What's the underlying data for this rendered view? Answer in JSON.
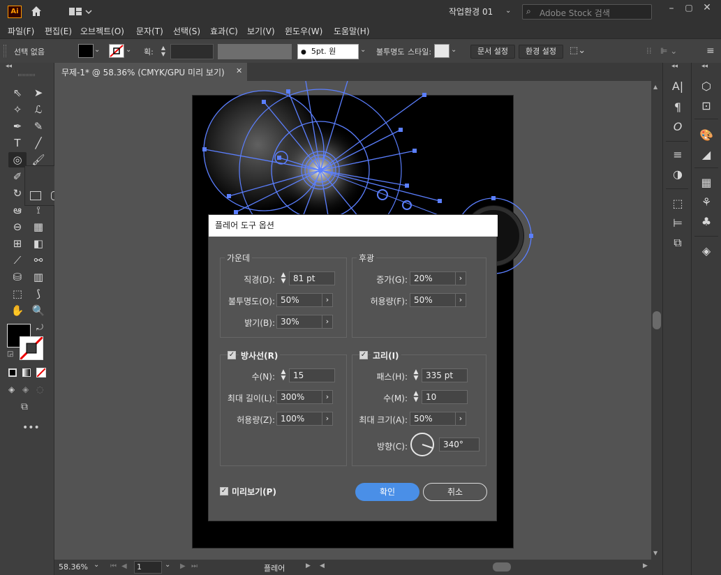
{
  "app": {
    "logo": "Ai",
    "workspace": "작업환경 01",
    "search_placeholder": "Adobe Stock 검색"
  },
  "menu": [
    "파일(F)",
    "편집(E)",
    "오브젝트(O)",
    "문자(T)",
    "선택(S)",
    "효과(C)",
    "보기(V)",
    "윈도우(W)",
    "도움말(H)"
  ],
  "control": {
    "selection": "선택 없음",
    "stroke_label": "획:",
    "brush": "5pt. 원",
    "opacity_label": "불투명도",
    "style_label": "스타일:",
    "doc_setup": "문서 설정",
    "prefs": "환경 설정"
  },
  "tab": {
    "title": "무제-1* @ 58.36% (CMYK/GPU 미리 보기)"
  },
  "status": {
    "zoom": "58.36%",
    "page": "1",
    "tool": "플레어"
  },
  "dialog": {
    "title": "플레어 도구 옵션",
    "center": {
      "title": "가운데",
      "diameter_label": "직경(D):",
      "diameter": "81 pt",
      "opacity_label": "불투명도(O):",
      "opacity": "50%",
      "brightness_label": "밝기(B):",
      "brightness": "30%"
    },
    "halo": {
      "title": "후광",
      "growth_label": "증가(G):",
      "growth": "20%",
      "fuzz_label": "허용량(F):",
      "fuzz": "50%"
    },
    "rays": {
      "title": "방사선(R)",
      "checked": true,
      "count_label": "수(N):",
      "count": "15",
      "longest_label": "최대 길이(L):",
      "longest": "300%",
      "fuzz_label": "허용량(Z):",
      "fuzz": "100%"
    },
    "rings": {
      "title": "고리(I)",
      "checked": true,
      "path_label": "패스(H):",
      "path": "335 pt",
      "count_label": "수(M):",
      "count": "10",
      "largest_label": "최대 크기(A):",
      "largest": "50%",
      "direction_label": "방향(C):",
      "direction": "340°"
    },
    "preview_label": "미리보기(P)",
    "preview_checked": true,
    "ok": "확인",
    "cancel": "취소"
  },
  "colors": {
    "accent": "#4a8fe7",
    "flare_path": "#5b7fff",
    "artboard": "#000000"
  }
}
